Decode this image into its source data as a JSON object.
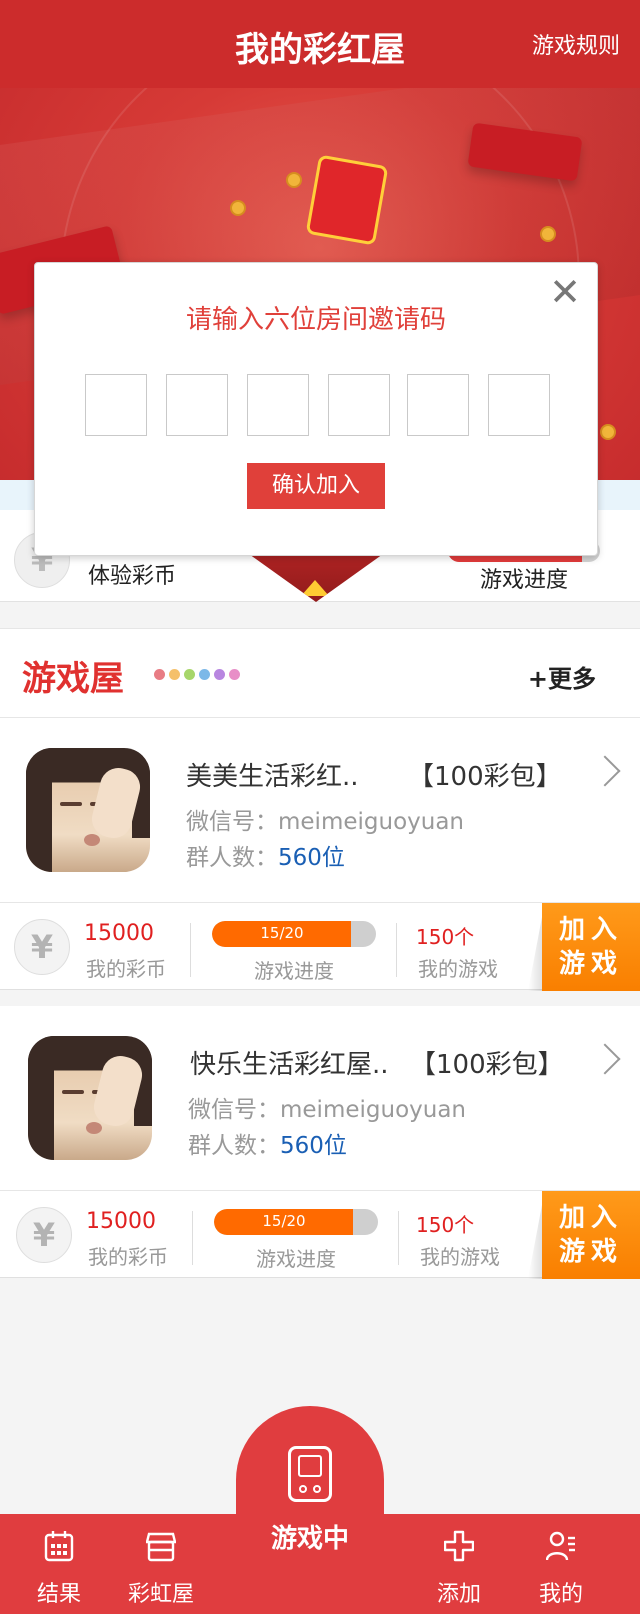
{
  "header": {
    "title": "我的彩红屋",
    "rules_link": "游戏规则"
  },
  "experience": {
    "coins_label": "体验彩币",
    "progress_label": "游戏进度",
    "yen_icon": "¥"
  },
  "section": {
    "title": "游戏屋",
    "more": "+更多",
    "dot_colors": [
      "#e87c84",
      "#f5c06b",
      "#a7d66a",
      "#7cb8e8",
      "#b886e0",
      "#e88ec7"
    ]
  },
  "cards": [
    {
      "name": "美美生活彩红..",
      "bonus": "【100彩包】",
      "wechat_label": "微信号：",
      "wechat_value": "meimeiguoyuan",
      "members_label": "群人数：",
      "members_value": "560位",
      "coins_value": "15000",
      "coins_label": "我的彩币",
      "progress_text": "15/20",
      "progress_fraction": 0.85,
      "progress_label": "游戏进度",
      "games_value": "150个",
      "games_label": "我的游戏",
      "join_label": "加入游戏",
      "yen_icon": "¥"
    },
    {
      "name": "快乐生活彩红屋..",
      "bonus": "【100彩包】",
      "wechat_label": "微信号：",
      "wechat_value": "meimeiguoyuan",
      "members_label": "群人数：",
      "members_value": "560位",
      "coins_value": "15000",
      "coins_label": "我的彩币",
      "progress_text": "15/20",
      "progress_fraction": 0.85,
      "progress_label": "游戏进度",
      "games_value": "150个",
      "games_label": "我的游戏",
      "join_label": "加入游戏",
      "yen_icon": "¥"
    }
  ],
  "modal": {
    "title": "请输入六位房间邀请码",
    "close_icon": "✕",
    "code_slots": 6,
    "confirm_label": "确认加入"
  },
  "tabbar": {
    "items": [
      {
        "label": "结果",
        "icon": "calendar-icon"
      },
      {
        "label": "彩虹屋",
        "icon": "store-icon"
      },
      {
        "label": "游戏中",
        "icon": "gamepad-icon"
      },
      {
        "label": "添加",
        "icon": "plus-icon"
      },
      {
        "label": "我的",
        "icon": "user-list-icon"
      }
    ]
  },
  "colors": {
    "brand_red": "#e03d3f",
    "accent_orange": "#ff6a00",
    "link_blue": "#1a5fb4"
  }
}
